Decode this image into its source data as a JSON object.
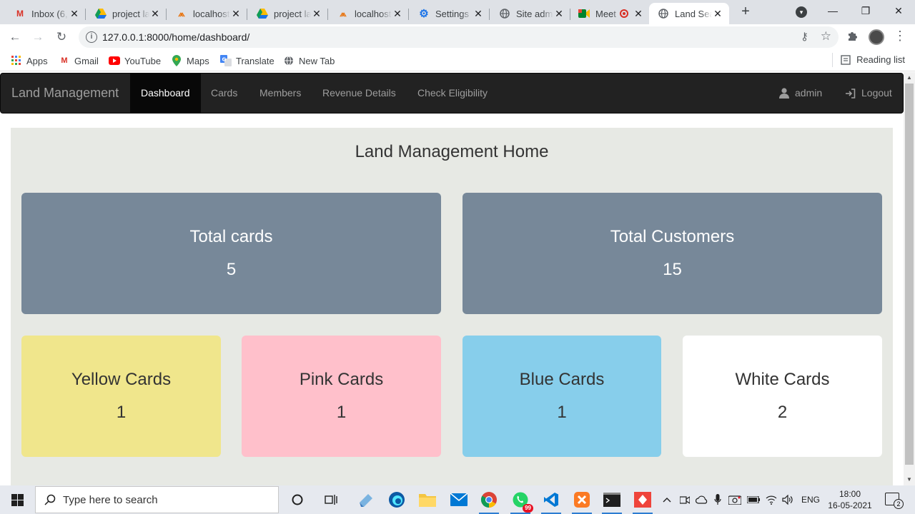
{
  "browser": {
    "tabs": [
      {
        "title": "Inbox (6,",
        "icon": "gmail-icon",
        "color": "#d93025"
      },
      {
        "title": "project la",
        "icon": "drive-icon",
        "color": "#1a73e8"
      },
      {
        "title": "localhost",
        "icon": "phpmyadmin-icon",
        "color": "#e8710a"
      },
      {
        "title": "project la",
        "icon": "drive-icon",
        "color": "#1a73e8"
      },
      {
        "title": "localhost",
        "icon": "phpmyadmin-icon",
        "color": "#e8710a"
      },
      {
        "title": "Settings",
        "icon": "gear-icon",
        "color": "#1a73e8"
      },
      {
        "title": "Site adm",
        "icon": "globe-icon",
        "color": "#5f6368"
      },
      {
        "title": "Meet",
        "icon": "meet-icon",
        "color": "#00832d"
      },
      {
        "title": "Land Sea",
        "icon": "globe-icon",
        "color": "#5f6368"
      }
    ],
    "url": "127.0.0.1:8000/home/dashboard/",
    "bookmarks": [
      {
        "label": "Apps",
        "icon": "apps-grid-icon"
      },
      {
        "label": "Gmail",
        "icon": "gmail-icon"
      },
      {
        "label": "YouTube",
        "icon": "youtube-icon"
      },
      {
        "label": "Maps",
        "icon": "maps-icon"
      },
      {
        "label": "Translate",
        "icon": "translate-icon"
      },
      {
        "label": "New Tab",
        "icon": "globe-icon"
      }
    ],
    "reading_list": "Reading list"
  },
  "app": {
    "brand": "Land Management",
    "nav": [
      {
        "label": "Dashboard",
        "active": true
      },
      {
        "label": "Cards",
        "active": false
      },
      {
        "label": "Members",
        "active": false
      },
      {
        "label": "Revenue Details",
        "active": false
      },
      {
        "label": "Check Eligibility",
        "active": false
      }
    ],
    "user": "admin",
    "logout": "Logout"
  },
  "dashboard": {
    "title": "Land Management Home",
    "totals": [
      {
        "label": "Total cards",
        "value": "5"
      },
      {
        "label": "Total Customers",
        "value": "15"
      }
    ],
    "cards": [
      {
        "label": "Yellow Cards",
        "value": "1",
        "color": "#f0e68c"
      },
      {
        "label": "Pink Cards",
        "value": "1",
        "color": "#ffc0cb"
      },
      {
        "label": "Blue Cards",
        "value": "1",
        "color": "#87ceeb"
      },
      {
        "label": "White Cards",
        "value": "2",
        "color": "#ffffff"
      }
    ]
  },
  "taskbar": {
    "search_placeholder": "Type here to search",
    "whatsapp_badge": "99",
    "language": "ENG",
    "time": "18:00",
    "date": "16-05-2021",
    "notifications": "2"
  }
}
